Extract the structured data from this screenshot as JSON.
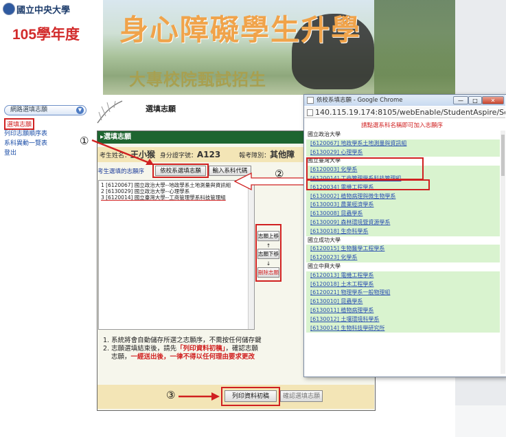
{
  "header": {
    "school_name": "國立中央大學",
    "year_label": "105學年度",
    "main_title": "身心障礙學生升學",
    "sub_title": "大專校院甄試招生"
  },
  "sidebar": {
    "dropdown_label": "網路選填志願",
    "items": [
      {
        "label": "選填志願"
      },
      {
        "label": "列印志願順序表"
      },
      {
        "label": "系科異動一覽表"
      },
      {
        "label": "登出"
      }
    ]
  },
  "main": {
    "page_title": "選填志願",
    "panel_title": "▸選填志願",
    "student_name_label": "考生姓名：",
    "student_name": "王小猴",
    "id_label": "身分證字號：",
    "id_value": "A123",
    "exam_category_label": "報考障別：",
    "exam_category_value": "其他障",
    "choice_order_label": "考生選填的志願序",
    "btn_select_by_school": "依校系選填志願",
    "btn_enter_code": "輸入系科代碼",
    "choices": [
      "1 [6120067] 國立政治大學--地政學系土地測量與資訊組",
      "2 [6130029] 國立政治大學--心理學系",
      "3 [6120014] 國立臺灣大學--工商管理學系科技管理組"
    ],
    "btn_move_up": "志願上移↑",
    "btn_move_down": "志願下移↓",
    "btn_delete": "刪除志願",
    "notes": [
      "1. 系統將會自動儲存所選之志願序，不需按任何儲存鍵",
      "2. 志願選填結束後，請先",
      "「列印資料初稿」",
      "，確認志願",
      "志願，",
      "一經送出後，一律不得以任何理由要求更改"
    ],
    "btn_print_draft": "列印資料初稿",
    "btn_confirm": "確認選填志願"
  },
  "annotations": {
    "step1": "①",
    "step2": "②",
    "step3": "③"
  },
  "popup": {
    "window_title": "依校系填志願 - Google Chrome",
    "url": "140.115.19.174:8105/webEnable/StudentAspire/Se",
    "hint": "請點選系科名稱即可加入志願序",
    "win_minimize": "—",
    "win_maximize": "□",
    "win_close": "✕",
    "rows": [
      {
        "kind": "school",
        "text": "國立政治大學"
      },
      {
        "kind": "dept",
        "text": "[6120067] 地政學系土地測量與資訊組"
      },
      {
        "kind": "dept",
        "text": "[6130029] 心理學系"
      },
      {
        "kind": "school",
        "text": "國立臺灣大學"
      },
      {
        "kind": "dept",
        "text": "[6120003] 化學系"
      },
      {
        "kind": "dept",
        "text": "[6120014] 工商管理學系科技管理組"
      },
      {
        "kind": "dept",
        "text": "[6120034] 電機工程學系"
      },
      {
        "kind": "dept",
        "text": "[6130002] 植物病理與微生物學系"
      },
      {
        "kind": "dept",
        "text": "[6130003] 農業經濟學系"
      },
      {
        "kind": "dept",
        "text": "[6130008] 昆蟲學系"
      },
      {
        "kind": "dept",
        "text": "[6130009] 森林環境暨資源學系"
      },
      {
        "kind": "dept",
        "text": "[6130018] 生命科學系"
      },
      {
        "kind": "school",
        "text": "國立成功大學"
      },
      {
        "kind": "dept",
        "text": "[6120015] 生物醫學工程學系"
      },
      {
        "kind": "dept",
        "text": "[6120023] 化學系"
      },
      {
        "kind": "school",
        "text": "國立中興大學"
      },
      {
        "kind": "dept",
        "text": "[6120013] 電機工程學系"
      },
      {
        "kind": "dept",
        "text": "[6120018] 土木工程學系"
      },
      {
        "kind": "dept",
        "text": "[6120021] 物理學系一般物理組"
      },
      {
        "kind": "dept",
        "text": "[6130010] 昆蟲學系"
      },
      {
        "kind": "dept",
        "text": "[6130011] 植物病理學系"
      },
      {
        "kind": "dept",
        "text": "[6130012] 土壤環境科學系"
      },
      {
        "kind": "dept",
        "text": "[6130014] 生物科技學研究所"
      }
    ]
  },
  "colors": {
    "accent_red": "#d02020",
    "panel_green": "#1e6530",
    "dept_row_bg": "#d9f3cf",
    "link_blue": "#2a4fb0"
  }
}
